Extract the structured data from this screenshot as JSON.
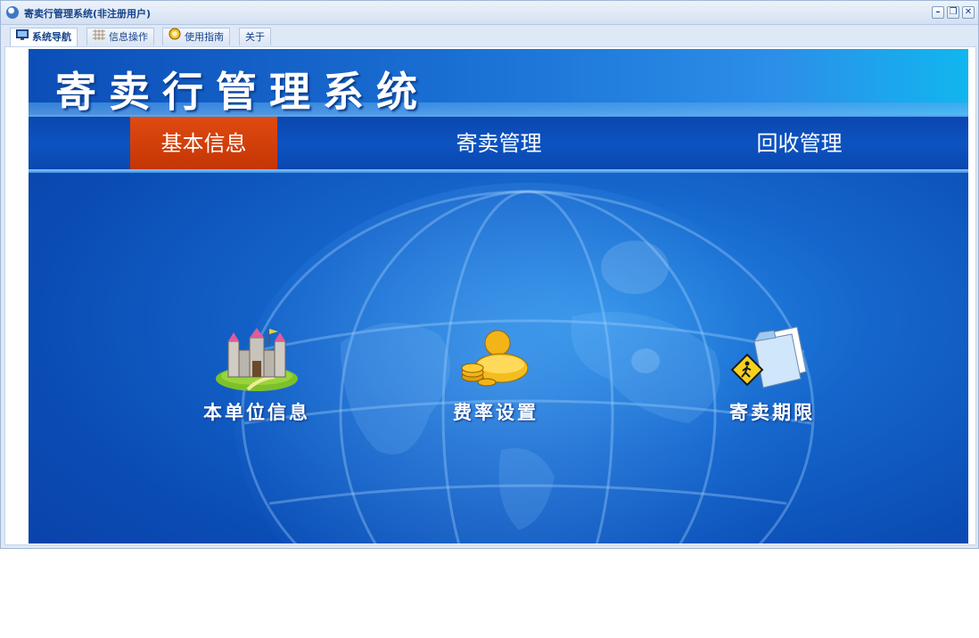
{
  "window": {
    "title": "寄卖行管理系统(非注册用户)"
  },
  "tabs": [
    {
      "label": "系统导航",
      "icon": "monitor-icon",
      "active": true
    },
    {
      "label": "信息操作",
      "icon": "grid-icon",
      "active": false
    },
    {
      "label": "使用指南",
      "icon": "guide-icon",
      "active": false
    },
    {
      "label": "关于",
      "icon": "",
      "active": false
    }
  ],
  "header": {
    "title": "寄卖行管理系统"
  },
  "nav": [
    {
      "label": "基本信息",
      "active": true
    },
    {
      "label": "寄卖管理",
      "active": false
    },
    {
      "label": "回收管理",
      "active": false
    }
  ],
  "tiles": [
    {
      "label": "本单位信息",
      "icon": "castle-icon"
    },
    {
      "label": "费率设置",
      "icon": "money-icon"
    },
    {
      "label": "寄卖期限",
      "icon": "folder-warning-icon"
    }
  ],
  "colors": {
    "accent": "#c8390a",
    "banner": "#1566cc"
  }
}
